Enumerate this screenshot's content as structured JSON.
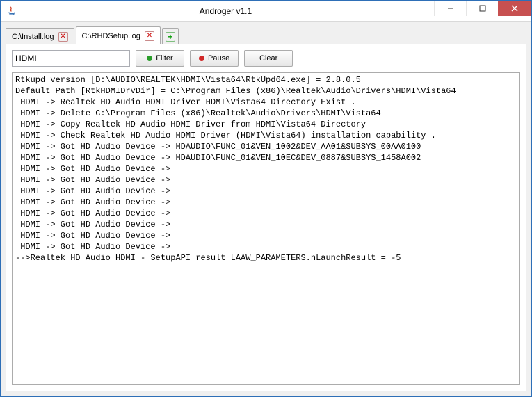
{
  "window": {
    "title": "Androger v1.1"
  },
  "tabs": [
    {
      "label": "C:\\Install.log",
      "active": false
    },
    {
      "label": "C:\\RHDSetup.log",
      "active": true
    }
  ],
  "toolbar": {
    "filter_value": "HDMI",
    "filter_label": "Filter",
    "pause_label": "Pause",
    "clear_label": "Clear"
  },
  "log_lines": [
    "Rtkupd version [D:\\AUDIO\\REALTEK\\HDMI\\Vista64\\RtkUpd64.exe] = 2.8.0.5",
    "Default Path [RtkHDMIDrvDir] = C:\\Program Files (x86)\\Realtek\\Audio\\Drivers\\HDMI\\Vista64",
    " HDMI -> Realtek HD Audio HDMI Driver HDMI\\Vista64 Directory Exist .",
    " HDMI -> Delete C:\\Program Files (x86)\\Realtek\\Audio\\Drivers\\HDMI\\Vista64",
    " HDMI -> Copy Realtek HD Audio HDMI Driver from HDMI\\Vista64 Directory",
    " HDMI -> Check Realtek HD Audio HDMI Driver (HDMI\\Vista64) installation capability .",
    " HDMI -> Got HD Audio Device -> HDAUDIO\\FUNC_01&VEN_1002&DEV_AA01&SUBSYS_00AA0100",
    " HDMI -> Got HD Audio Device -> HDAUDIO\\FUNC_01&VEN_10EC&DEV_0887&SUBSYS_1458A002",
    " HDMI -> Got HD Audio Device ->",
    " HDMI -> Got HD Audio Device ->",
    " HDMI -> Got HD Audio Device ->",
    " HDMI -> Got HD Audio Device ->",
    " HDMI -> Got HD Audio Device ->",
    " HDMI -> Got HD Audio Device ->",
    " HDMI -> Got HD Audio Device ->",
    " HDMI -> Got HD Audio Device ->",
    "-->Realtek HD Audio HDMI - SetupAPI result LAAW_PARAMETERS.nLaunchResult = -5"
  ]
}
